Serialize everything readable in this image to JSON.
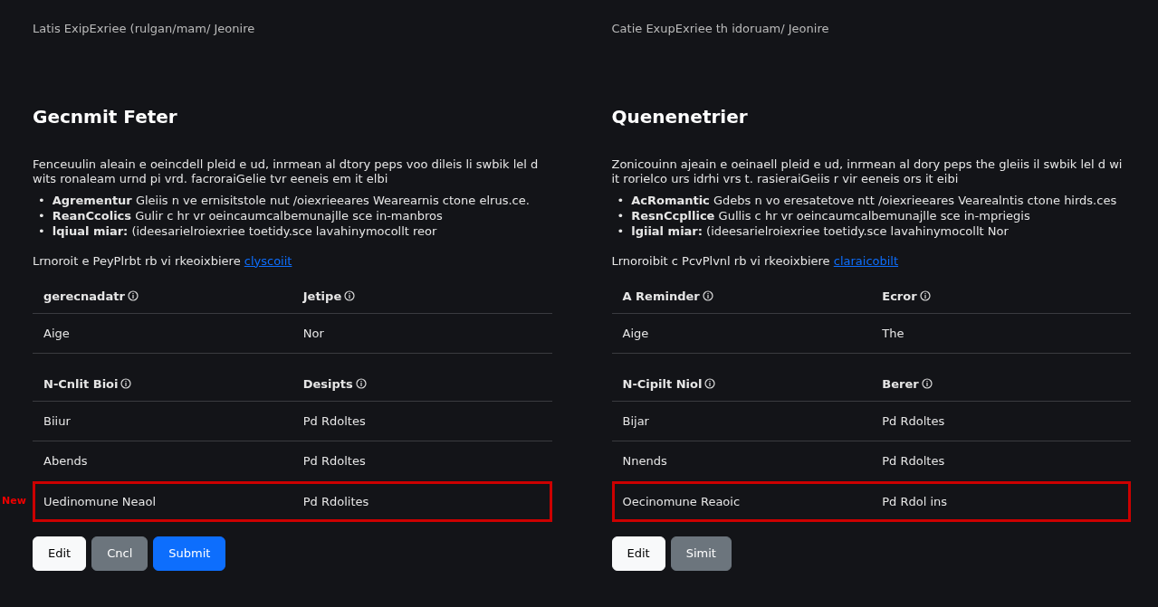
{
  "panels": [
    {
      "breadcrumb": "Latis ExipExriee (rulgan/mam/ Jeonire",
      "heading": "Gecnmit Feter",
      "paragraph": "Fenceuulin aleain e oeincdell pleid e ud, inrmean al dtory peps voo dileis li swbik lel d wits ronaleam urnd pi vrd. facroraiGelie tvr eeneis em it elbi",
      "bullets": [
        {
          "marker": "•",
          "lead": "Agrementur",
          "text": "Gleiis n ve ernisitstole nut /oiexrieeares Wearearnis ctone elrus.ce."
        },
        {
          "marker": "•",
          "lead": "ReanCcolics",
          "text": "Gulir c hr vr oeincaumcalbemunajlle sce in-manbros"
        },
        {
          "marker": "•",
          "lead": "lqiual miar:",
          "text": "(ideesarielroiexriee toetidy.sce lavahinymocollt reor"
        }
      ],
      "note": "Lrnoroit e PeyPlrbt rb vi rkeoixbiere",
      "note_link": "clyscoiit",
      "tables": [
        {
          "columns": [
            "gerecnadatr",
            "Jetipe"
          ],
          "rows": [
            {
              "cells": [
                "Aige",
                "Nor"
              ],
              "flagged": false
            }
          ]
        },
        {
          "columns": [
            "N-Cnlit Bioi",
            "Desipts"
          ],
          "rows": [
            {
              "cells": [
                "Biiur",
                "Pd Rdoltes"
              ],
              "flagged": false
            },
            {
              "cells": [
                "Abends",
                "Pd Rdoltes"
              ],
              "flagged": false
            },
            {
              "cells": [
                "Uedinomune Neaol",
                "Pd Rdolites"
              ],
              "flagged": true,
              "flag": "New"
            }
          ]
        }
      ],
      "buttons": [
        {
          "label": "Edit",
          "kind": "light"
        },
        {
          "label": "Cncl",
          "kind": "secondary"
        },
        {
          "label": "Submit",
          "kind": "primary"
        }
      ]
    },
    {
      "breadcrumb": "Catie ExupExriee th idoruam/ Jeonire",
      "heading": "Quenenetrier",
      "paragraph": "Zonicouinn ajeain e oeinaell pleid e ud, inrmean al dory peps the gleiis il swbik lel d wi it rorielco urs idrhi vrs t. rasieraiGeiis r vir eeneis ors it eibi",
      "bullets": [
        {
          "marker": "•",
          "lead": "AcRomantic",
          "text": "Gdebs n vo eresatetove ntt /oiexrieeares Vearealntis ctone hirds.ces"
        },
        {
          "marker": "•",
          "lead": "ResnCcpllice",
          "text": "Gullis c hr vr oeincaumcalbemunajlle sce in-mpriegis"
        },
        {
          "marker": "•",
          "lead": "lgiial miar:",
          "text": "(ideesarielroiexriee toetidy.sce lavahinymocollt Nor"
        }
      ],
      "note": "Lrnoroibit c PcvPlvnl rb vi rkeoixbiere",
      "note_link": "claraicobilt",
      "tables": [
        {
          "columns": [
            "A Reminder",
            "Ecror"
          ],
          "rows": [
            {
              "cells": [
                "Aige",
                "The"
              ],
              "flagged": false
            }
          ]
        },
        {
          "columns": [
            "N-Cipilt Niol",
            "Berer"
          ],
          "rows": [
            {
              "cells": [
                "Bijar",
                "Pd Rdoltes"
              ],
              "flagged": false
            },
            {
              "cells": [
                "Nnends",
                "Pd Rdoltes"
              ],
              "flagged": false
            },
            {
              "cells": [
                "Oecinomune Reaoic",
                "Pd Rdol ins"
              ],
              "flagged": true
            }
          ]
        }
      ],
      "buttons": [
        {
          "label": "Edit",
          "kind": "light"
        },
        {
          "label": "Simit",
          "kind": "secondary"
        }
      ]
    }
  ]
}
